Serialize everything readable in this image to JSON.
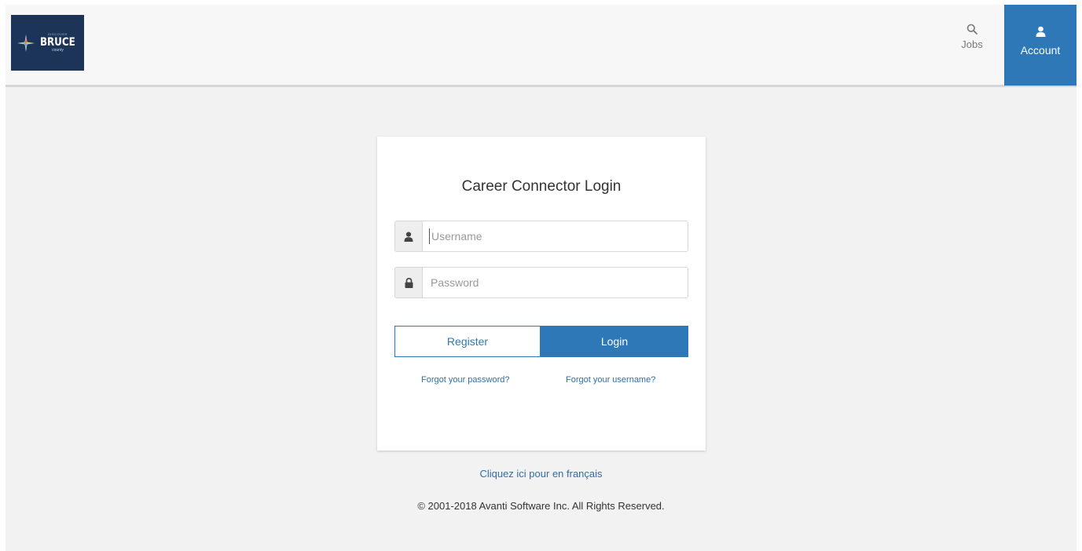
{
  "header": {
    "logo": {
      "top_text": "DISCOVER",
      "main_text": "BRUCE",
      "sub_text": "county"
    },
    "nav": {
      "jobs_label": "Jobs",
      "account_label": "Account"
    }
  },
  "login": {
    "title": "Career Connector Login",
    "username_placeholder": "Username",
    "password_placeholder": "Password",
    "register_label": "Register",
    "login_label": "Login",
    "forgot_password": "Forgot your password?",
    "forgot_username": "Forgot your username?"
  },
  "footer": {
    "french_link": "Cliquez ici pour en français",
    "copyright": "© 2001-2018 Avanti Software Inc. All Rights Reserved."
  },
  "colors": {
    "accent": "#2f78b8",
    "logo_bg": "#1c3457",
    "page_bg": "#f2f2f2"
  },
  "icons": {
    "search": "search-icon",
    "account": "user-icon",
    "username_addon": "user-icon",
    "password_addon": "lock-icon",
    "logo": "compass-star-icon"
  }
}
